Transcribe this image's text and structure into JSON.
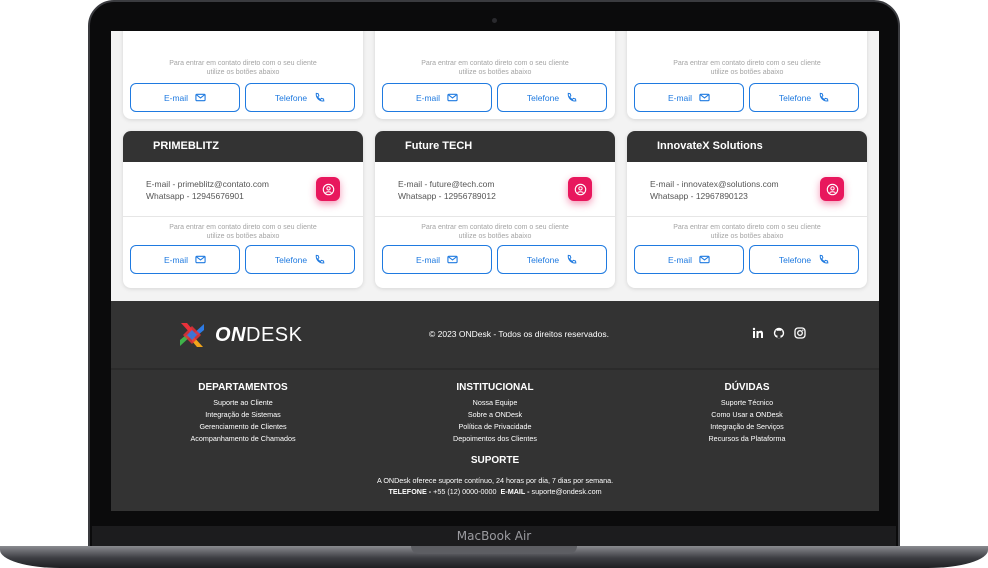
{
  "device": {
    "label": "MacBook Air"
  },
  "cards_top": [
    {
      "hint_line1": "Para entrar em contato direto com o seu cliente",
      "hint_line2": "utilize os botões abaixo",
      "email_label": "E-mail",
      "phone_label": "Telefone"
    },
    {
      "hint_line1": "Para entrar em contato direto com o seu cliente",
      "hint_line2": "utilize os botões abaixo",
      "email_label": "E-mail",
      "phone_label": "Telefone"
    },
    {
      "hint_line1": "Para entrar em contato direto com o seu cliente",
      "hint_line2": "utilize os botões abaixo",
      "email_label": "E-mail",
      "phone_label": "Telefone"
    }
  ],
  "cards": [
    {
      "name": "PRIMEBLITZ",
      "email_line": "E-mail - primeblitz@contato.com",
      "whatsapp_line": "Whatsapp - 12945676901",
      "hint_line1": "Para entrar em contato direto com o seu cliente",
      "hint_line2": "utilize os botões abaixo",
      "email_label": "E-mail",
      "phone_label": "Telefone"
    },
    {
      "name": "Future TECH",
      "email_line": "E-mail - future@tech.com",
      "whatsapp_line": "Whatsapp - 12956789012",
      "hint_line1": "Para entrar em contato direto com o seu cliente",
      "hint_line2": "utilize os botões abaixo",
      "email_label": "E-mail",
      "phone_label": "Telefone"
    },
    {
      "name": "InnovateX Solutions",
      "email_line": "E-mail - innovatex@solutions.com",
      "whatsapp_line": "Whatsapp - 12967890123",
      "hint_line1": "Para entrar em contato direto com o seu cliente",
      "hint_line2": "utilize os botões abaixo",
      "email_label": "E-mail",
      "phone_label": "Telefone"
    }
  ],
  "footer": {
    "logo_bold": "ON",
    "logo_light": "DESK",
    "copyright": "© 2023 ONDesk - Todos os direitos reservados.",
    "social_icons": [
      "linkedin-icon",
      "github-icon",
      "instagram-icon"
    ],
    "columns": [
      {
        "title": "DEPARTAMENTOS",
        "links": [
          "Suporte ao Cliente",
          "Integração de Sistemas",
          "Gerenciamento de Clientes",
          "Acompanhamento de Chamados"
        ]
      },
      {
        "title": "INSTITUCIONAL",
        "links": [
          "Nossa Equipe",
          "Sobre a ONDesk",
          "Política de Privacidade",
          "Depoimentos dos Clientes"
        ]
      },
      {
        "title": "DÚVIDAS",
        "links": [
          "Suporte Técnico",
          "Como Usar a ONDesk",
          "Integração de Serviços",
          "Recursos da Plataforma"
        ]
      }
    ],
    "support": {
      "title": "SUPORTE",
      "text": "A ONDesk oferece suporte contínuo, 24 horas por dia, 7 dias por semana.",
      "phone_label": "TELEFONE -",
      "phone": "+55 (12) 0000-0000",
      "email_label": "E-MAIL -",
      "email": "suporte@ondesk.com"
    }
  },
  "colors": {
    "accent": "#e8175d",
    "primary": "#1f7ae0",
    "dark": "#333333"
  }
}
